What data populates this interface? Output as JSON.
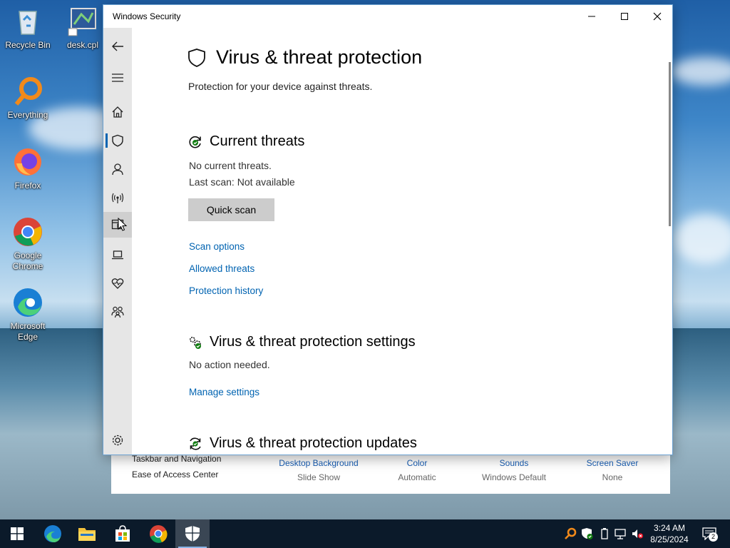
{
  "desktop": {
    "icons": [
      {
        "label": "Recycle Bin"
      },
      {
        "label": "desk.cpl"
      },
      {
        "label": "Everything"
      },
      {
        "label": "Firefox"
      },
      {
        "label": "Google Chrome"
      },
      {
        "label": "Microsoft Edge"
      }
    ]
  },
  "background_window": {
    "left_items": [
      "Taskbar and Navigation",
      "Ease of Access Center"
    ],
    "columns": [
      {
        "title": "Desktop Background",
        "value": "Slide Show"
      },
      {
        "title": "Color",
        "value": "Automatic"
      },
      {
        "title": "Sounds",
        "value": "Windows Default"
      },
      {
        "title": "Screen Saver",
        "value": "None"
      }
    ]
  },
  "window": {
    "title": "Windows Security",
    "page_title": "Virus & threat protection",
    "page_subtitle": "Protection for your device against threats.",
    "current_threats": {
      "title": "Current threats",
      "status": "No current threats.",
      "last_scan": "Last scan: Not available",
      "quick_scan_label": "Quick scan",
      "links": [
        "Scan options",
        "Allowed threats",
        "Protection history"
      ]
    },
    "settings": {
      "title": "Virus & threat protection settings",
      "status": "No action needed.",
      "link": "Manage settings"
    },
    "updates": {
      "title": "Virus & threat protection updates"
    },
    "nav_items": [
      "back",
      "menu",
      "home",
      "virus-protection",
      "account",
      "firewall",
      "app-browser-control",
      "device-security",
      "device-health",
      "family-options",
      "settings"
    ],
    "active_nav": "virus-protection"
  },
  "taskbar": {
    "apps": [
      "start",
      "edge",
      "file-explorer",
      "store",
      "chrome",
      "windows-security"
    ],
    "active_app": "windows-security",
    "time": "3:24 AM",
    "date": "8/25/2024",
    "notification_count": "2"
  }
}
